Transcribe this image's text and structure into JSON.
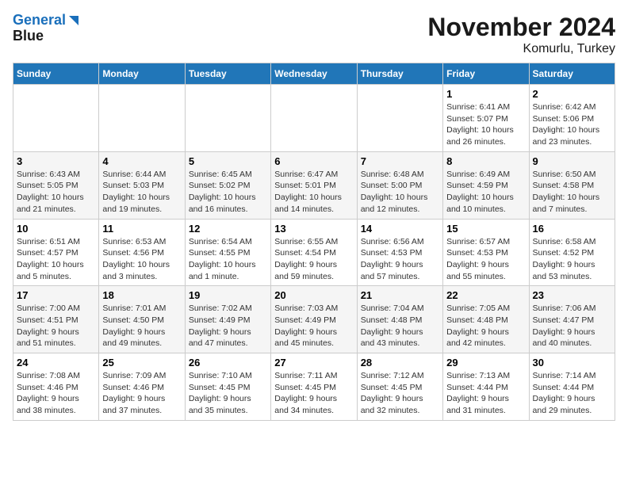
{
  "header": {
    "logo_line1": "General",
    "logo_line2": "Blue",
    "title": "November 2024",
    "subtitle": "Komurlu, Turkey"
  },
  "weekdays": [
    "Sunday",
    "Monday",
    "Tuesday",
    "Wednesday",
    "Thursday",
    "Friday",
    "Saturday"
  ],
  "weeks": [
    [
      {
        "day": "",
        "info": ""
      },
      {
        "day": "",
        "info": ""
      },
      {
        "day": "",
        "info": ""
      },
      {
        "day": "",
        "info": ""
      },
      {
        "day": "",
        "info": ""
      },
      {
        "day": "1",
        "info": "Sunrise: 6:41 AM\nSunset: 5:07 PM\nDaylight: 10 hours\nand 26 minutes."
      },
      {
        "day": "2",
        "info": "Sunrise: 6:42 AM\nSunset: 5:06 PM\nDaylight: 10 hours\nand 23 minutes."
      }
    ],
    [
      {
        "day": "3",
        "info": "Sunrise: 6:43 AM\nSunset: 5:05 PM\nDaylight: 10 hours\nand 21 minutes."
      },
      {
        "day": "4",
        "info": "Sunrise: 6:44 AM\nSunset: 5:03 PM\nDaylight: 10 hours\nand 19 minutes."
      },
      {
        "day": "5",
        "info": "Sunrise: 6:45 AM\nSunset: 5:02 PM\nDaylight: 10 hours\nand 16 minutes."
      },
      {
        "day": "6",
        "info": "Sunrise: 6:47 AM\nSunset: 5:01 PM\nDaylight: 10 hours\nand 14 minutes."
      },
      {
        "day": "7",
        "info": "Sunrise: 6:48 AM\nSunset: 5:00 PM\nDaylight: 10 hours\nand 12 minutes."
      },
      {
        "day": "8",
        "info": "Sunrise: 6:49 AM\nSunset: 4:59 PM\nDaylight: 10 hours\nand 10 minutes."
      },
      {
        "day": "9",
        "info": "Sunrise: 6:50 AM\nSunset: 4:58 PM\nDaylight: 10 hours\nand 7 minutes."
      }
    ],
    [
      {
        "day": "10",
        "info": "Sunrise: 6:51 AM\nSunset: 4:57 PM\nDaylight: 10 hours\nand 5 minutes."
      },
      {
        "day": "11",
        "info": "Sunrise: 6:53 AM\nSunset: 4:56 PM\nDaylight: 10 hours\nand 3 minutes."
      },
      {
        "day": "12",
        "info": "Sunrise: 6:54 AM\nSunset: 4:55 PM\nDaylight: 10 hours\nand 1 minute."
      },
      {
        "day": "13",
        "info": "Sunrise: 6:55 AM\nSunset: 4:54 PM\nDaylight: 9 hours\nand 59 minutes."
      },
      {
        "day": "14",
        "info": "Sunrise: 6:56 AM\nSunset: 4:53 PM\nDaylight: 9 hours\nand 57 minutes."
      },
      {
        "day": "15",
        "info": "Sunrise: 6:57 AM\nSunset: 4:53 PM\nDaylight: 9 hours\nand 55 minutes."
      },
      {
        "day": "16",
        "info": "Sunrise: 6:58 AM\nSunset: 4:52 PM\nDaylight: 9 hours\nand 53 minutes."
      }
    ],
    [
      {
        "day": "17",
        "info": "Sunrise: 7:00 AM\nSunset: 4:51 PM\nDaylight: 9 hours\nand 51 minutes."
      },
      {
        "day": "18",
        "info": "Sunrise: 7:01 AM\nSunset: 4:50 PM\nDaylight: 9 hours\nand 49 minutes."
      },
      {
        "day": "19",
        "info": "Sunrise: 7:02 AM\nSunset: 4:49 PM\nDaylight: 9 hours\nand 47 minutes."
      },
      {
        "day": "20",
        "info": "Sunrise: 7:03 AM\nSunset: 4:49 PM\nDaylight: 9 hours\nand 45 minutes."
      },
      {
        "day": "21",
        "info": "Sunrise: 7:04 AM\nSunset: 4:48 PM\nDaylight: 9 hours\nand 43 minutes."
      },
      {
        "day": "22",
        "info": "Sunrise: 7:05 AM\nSunset: 4:48 PM\nDaylight: 9 hours\nand 42 minutes."
      },
      {
        "day": "23",
        "info": "Sunrise: 7:06 AM\nSunset: 4:47 PM\nDaylight: 9 hours\nand 40 minutes."
      }
    ],
    [
      {
        "day": "24",
        "info": "Sunrise: 7:08 AM\nSunset: 4:46 PM\nDaylight: 9 hours\nand 38 minutes."
      },
      {
        "day": "25",
        "info": "Sunrise: 7:09 AM\nSunset: 4:46 PM\nDaylight: 9 hours\nand 37 minutes."
      },
      {
        "day": "26",
        "info": "Sunrise: 7:10 AM\nSunset: 4:45 PM\nDaylight: 9 hours\nand 35 minutes."
      },
      {
        "day": "27",
        "info": "Sunrise: 7:11 AM\nSunset: 4:45 PM\nDaylight: 9 hours\nand 34 minutes."
      },
      {
        "day": "28",
        "info": "Sunrise: 7:12 AM\nSunset: 4:45 PM\nDaylight: 9 hours\nand 32 minutes."
      },
      {
        "day": "29",
        "info": "Sunrise: 7:13 AM\nSunset: 4:44 PM\nDaylight: 9 hours\nand 31 minutes."
      },
      {
        "day": "30",
        "info": "Sunrise: 7:14 AM\nSunset: 4:44 PM\nDaylight: 9 hours\nand 29 minutes."
      }
    ]
  ]
}
